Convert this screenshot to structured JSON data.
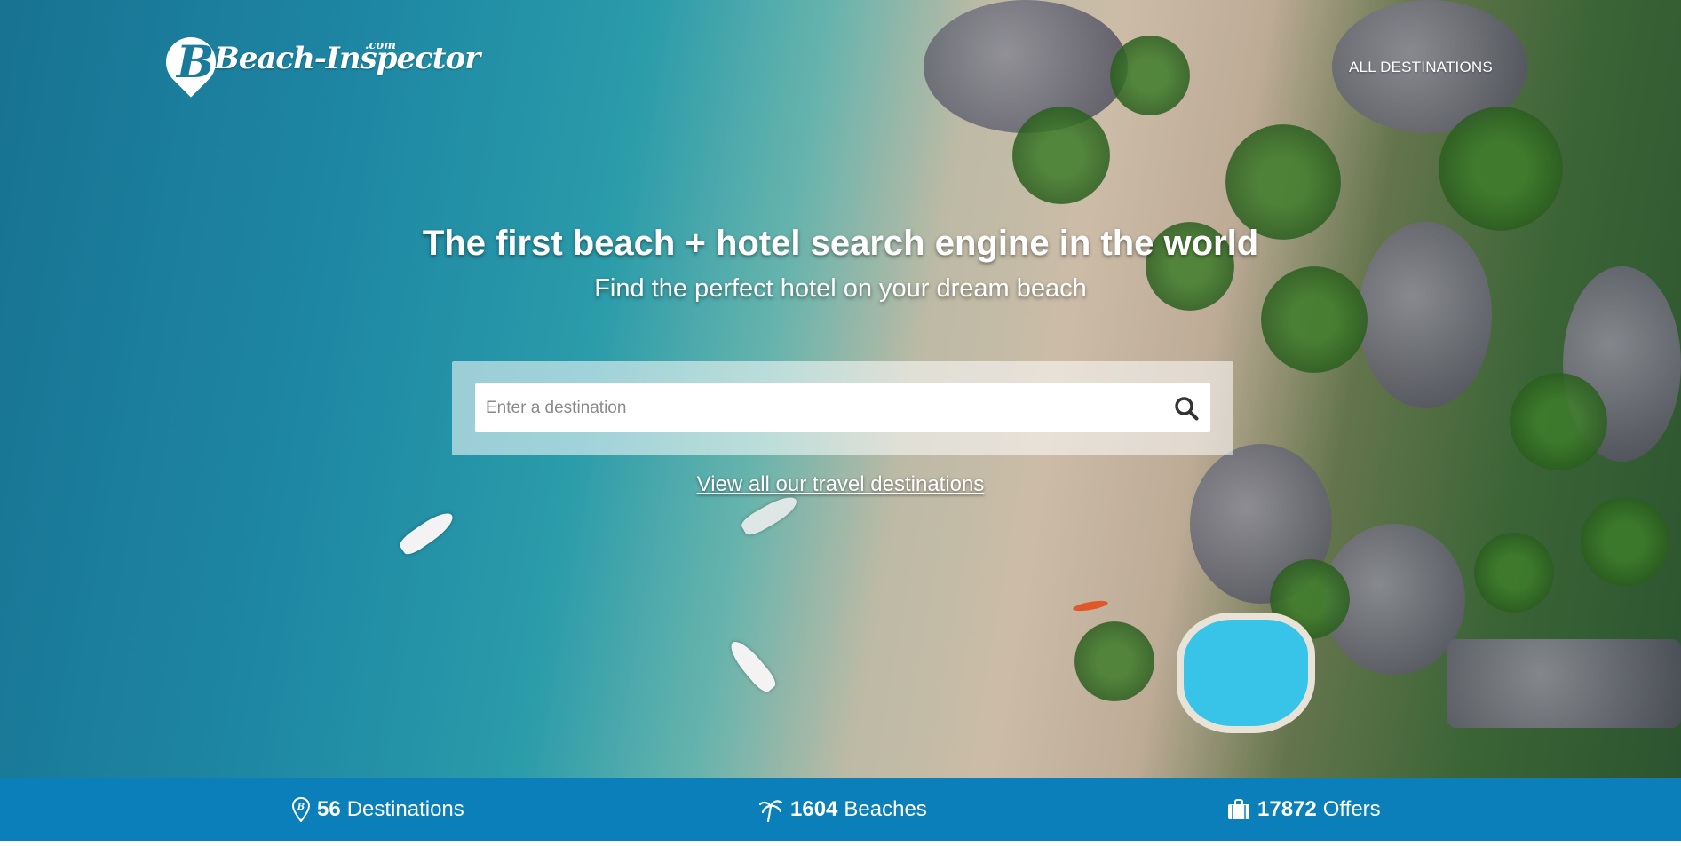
{
  "brand": {
    "logo_text": "Beach-Inspector",
    "logo_letter": "B",
    "logo_suffix": ".com"
  },
  "nav": {
    "all_destinations": "ALL DESTINATIONS"
  },
  "hero": {
    "headline": "The first beach + hotel search engine in the world",
    "subline": "Find the perfect hotel on your dream beach"
  },
  "search": {
    "placeholder": "Enter a destination",
    "value": ""
  },
  "links": {
    "view_all": "View all our travel destinations"
  },
  "stats": [
    {
      "count": "56",
      "label": "Destinations",
      "icon": "map-pin-icon"
    },
    {
      "count": "1604",
      "label": "Beaches",
      "icon": "palm-tree-icon"
    },
    {
      "count": "17872",
      "label": "Offers",
      "icon": "suitcase-icon"
    }
  ],
  "colors": {
    "stats_bar": "#0a7fb9",
    "text": "#ffffff"
  }
}
